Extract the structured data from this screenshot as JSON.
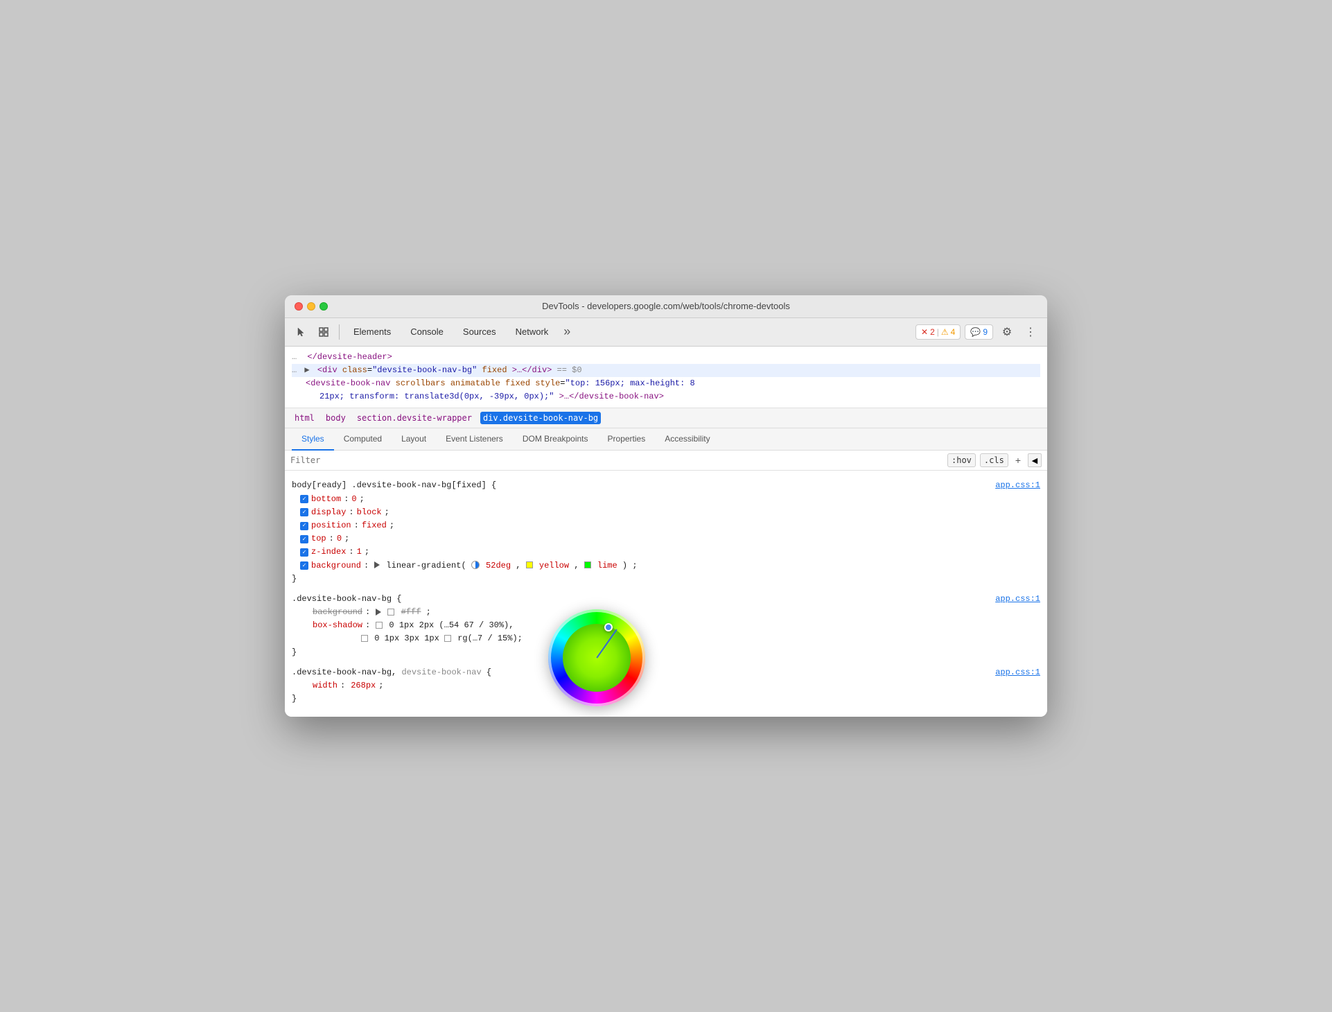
{
  "window": {
    "title": "DevTools - developers.google.com/web/tools/chrome-devtools"
  },
  "toolbar": {
    "tabs": [
      {
        "id": "elements",
        "label": "Elements"
      },
      {
        "id": "console",
        "label": "Console"
      },
      {
        "id": "sources",
        "label": "Sources"
      },
      {
        "id": "network",
        "label": "Network"
      }
    ],
    "more_label": "»",
    "badges": {
      "error_icon": "✕",
      "error_count": "2",
      "warning_icon": "⚠",
      "warning_count": "4",
      "info_icon": "💬",
      "info_count": "9"
    }
  },
  "dom": {
    "line1": "</devsite-header>",
    "line2_prefix": "▶",
    "line2_tag_open": "<div",
    "line2_attr1_name": "class",
    "line2_attr1_value": "\"devsite-book-nav-bg\"",
    "line2_attr2": "fixed",
    "line2_mid": ">…</div>",
    "line2_eq": "== $0",
    "line3_tag": "<devsite-book-nav",
    "line3_attrs": "scrollbars animatable fixed",
    "line3_style_name": "style",
    "line3_style_value": "\"top: 156px; max-height: 8",
    "line4": "21px; transform: translate3d(0px, -39px, 0px);\">…</devsite-book-nav>"
  },
  "breadcrumb": {
    "items": [
      {
        "id": "html",
        "label": "html",
        "active": false
      },
      {
        "id": "body",
        "label": "body",
        "active": false
      },
      {
        "id": "section",
        "label": "section.devsite-wrapper",
        "active": false
      },
      {
        "id": "div",
        "label": "div.devsite-book-nav-bg",
        "active": true
      }
    ]
  },
  "panel_tabs": {
    "tabs": [
      {
        "id": "styles",
        "label": "Styles",
        "active": true
      },
      {
        "id": "computed",
        "label": "Computed",
        "active": false
      },
      {
        "id": "layout",
        "label": "Layout",
        "active": false
      },
      {
        "id": "event_listeners",
        "label": "Event Listeners",
        "active": false
      },
      {
        "id": "dom_breakpoints",
        "label": "DOM Breakpoints",
        "active": false
      },
      {
        "id": "properties",
        "label": "Properties",
        "active": false
      },
      {
        "id": "accessibility",
        "label": "Accessibility",
        "active": false
      }
    ]
  },
  "filter": {
    "placeholder": "Filter",
    "hov_label": ":hov",
    "cls_label": ".cls",
    "add_label": "+",
    "collapse_label": "◀"
  },
  "styles": {
    "rule1": {
      "selector": "body[ready] .devsite-book-nav-bg[fixed] {",
      "source": "app.css:1",
      "properties": [
        {
          "checked": true,
          "name": "bottom",
          "value": "0;"
        },
        {
          "checked": true,
          "name": "display",
          "value": "block;"
        },
        {
          "checked": true,
          "name": "position",
          "value": "fixed;"
        },
        {
          "checked": true,
          "name": "top",
          "value": "0;"
        },
        {
          "checked": true,
          "name": "z-index",
          "value": "1;"
        },
        {
          "checked": true,
          "name": "background",
          "value": "▶ linear-gradient(⊙52deg, □yellow, □lime);"
        }
      ],
      "closing": "}"
    },
    "rule2": {
      "selector": ".devsite-book-nav-bg {",
      "source": "app.css:1",
      "properties": [
        {
          "checked": false,
          "strikethrough": true,
          "name": "background",
          "value": "▶ □#fff;"
        },
        {
          "checked": false,
          "name": "box-shadow",
          "value": "□0 1px 2px (...) 54 67 / 30%),"
        },
        {
          "checked": false,
          "name": "",
          "value": "□0 1px 3px 1px □rg(...7 / 15%);"
        }
      ],
      "closing": "}"
    },
    "rule3": {
      "selector": ".devsite-book-nav-bg, devsite-book-nav {",
      "source": "app.css:1",
      "properties": [
        {
          "checked": false,
          "name": "width",
          "value": "268px;"
        }
      ],
      "closing": "}"
    }
  },
  "color_picker": {
    "visible": true,
    "angle": 52
  }
}
